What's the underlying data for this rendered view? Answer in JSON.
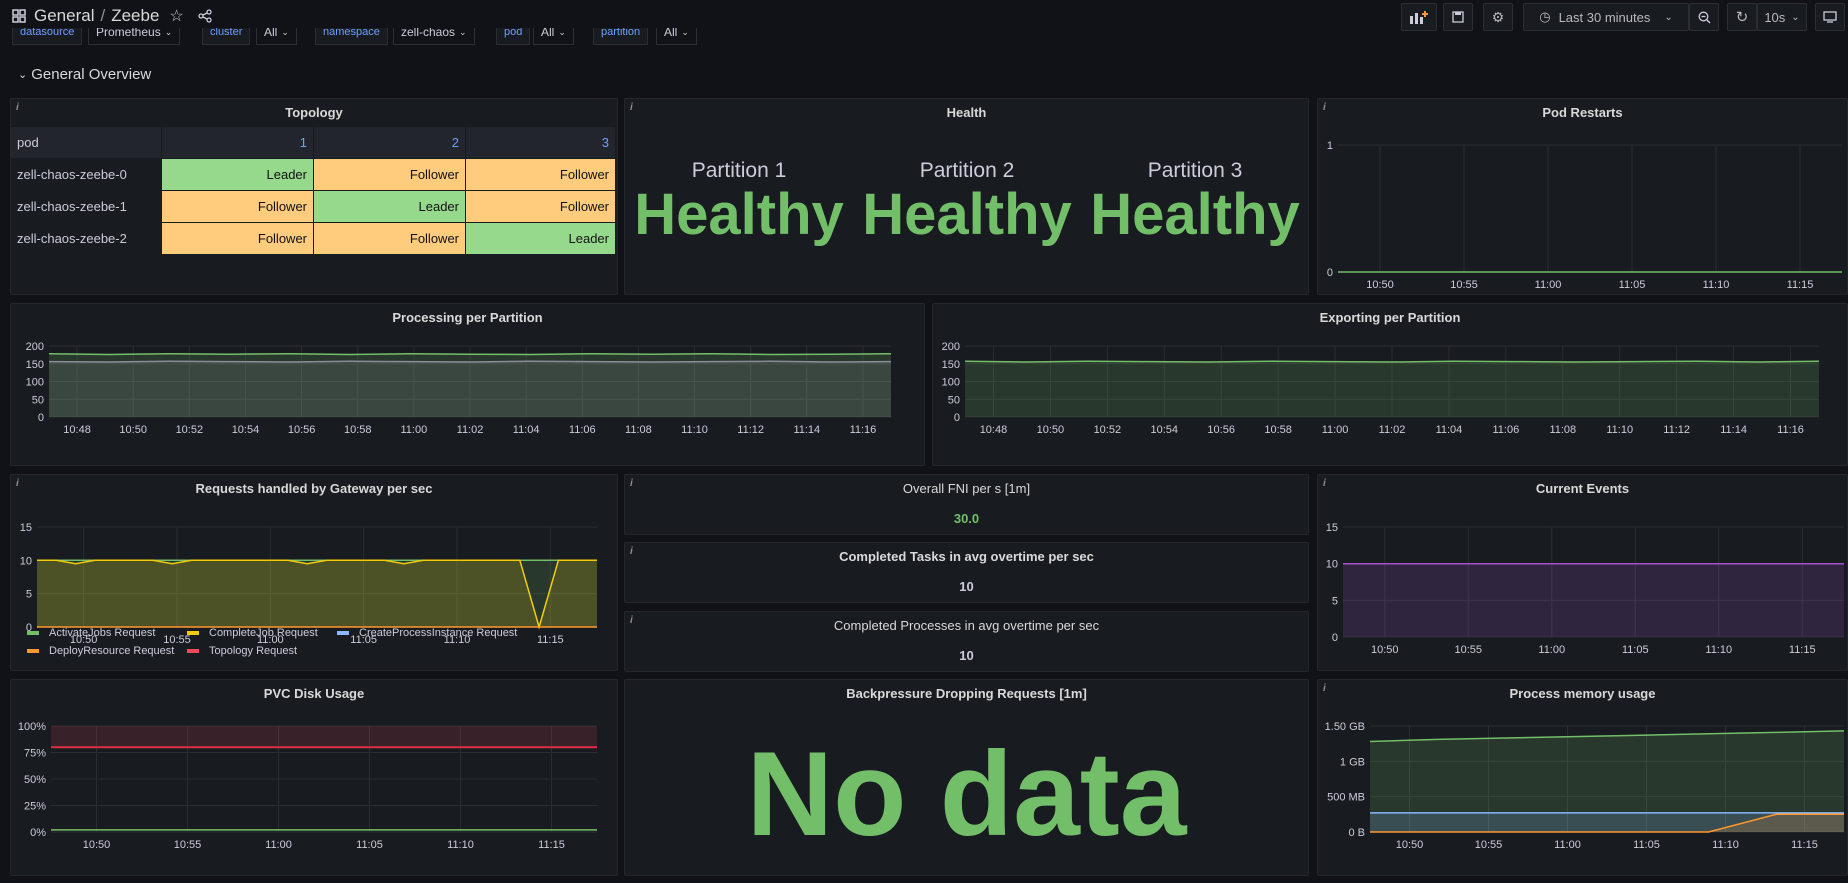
{
  "header": {
    "breadcrumb_folder": "General",
    "breadcrumb_sep": "/",
    "dashboard_title": "Zeebe",
    "time_range": "Last 30 minutes",
    "refresh_interval": "10s"
  },
  "variables": [
    {
      "label": "datasource",
      "value": "Prometheus"
    },
    {
      "label": "cluster",
      "value": "All"
    },
    {
      "label": "namespace",
      "value": "zell-chaos"
    },
    {
      "label": "pod",
      "value": "All"
    },
    {
      "label": "partition",
      "value": "All"
    }
  ],
  "row_title": "General Overview",
  "topology": {
    "title": "Topology",
    "columns": [
      "pod",
      "1",
      "2",
      "3"
    ],
    "rows": [
      {
        "pod": "zell-chaos-zeebe-0",
        "cells": [
          "Leader",
          "Follower",
          "Follower"
        ]
      },
      {
        "pod": "zell-chaos-zeebe-1",
        "cells": [
          "Follower",
          "Leader",
          "Follower"
        ]
      },
      {
        "pod": "zell-chaos-zeebe-2",
        "cells": [
          "Follower",
          "Follower",
          "Leader"
        ]
      }
    ]
  },
  "health": {
    "title": "Health",
    "partitions": [
      {
        "name": "Partition 1",
        "status": "Healthy"
      },
      {
        "name": "Partition 2",
        "status": "Healthy"
      },
      {
        "name": "Partition 3",
        "status": "Healthy"
      }
    ]
  },
  "pod_restarts": {
    "title": "Pod Restarts"
  },
  "processing": {
    "title": "Processing per Partition"
  },
  "exporting": {
    "title": "Exporting per Partition"
  },
  "gateway": {
    "title": "Requests handled by Gateway per sec",
    "legend": [
      {
        "name": "ActivateJobs Request",
        "color": "#73bf69"
      },
      {
        "name": "CompleteJob Request",
        "color": "#f2cc0c"
      },
      {
        "name": "CreateProcessInstance Request",
        "color": "#8ab8ff"
      },
      {
        "name": "DeployResource Request",
        "color": "#ff9830"
      },
      {
        "name": "Topology Request",
        "color": "#f2495c"
      }
    ]
  },
  "fni": {
    "title": "Overall FNI per s [1m]",
    "value": "30.0"
  },
  "completed_tasks": {
    "title": "Completed Tasks in avg overtime per sec",
    "value": "10"
  },
  "completed_processes": {
    "title": "Completed Processes in avg overtime per sec",
    "value": "10"
  },
  "current_events": {
    "title": "Current Events"
  },
  "pvc": {
    "title": "PVC Disk Usage"
  },
  "backpressure": {
    "title": "Backpressure Dropping Requests [1m]",
    "value": "No data"
  },
  "memory": {
    "title": "Process memory usage"
  },
  "chart_data": [
    {
      "id": "pod_restarts",
      "type": "line",
      "title": "Pod Restarts",
      "x": [
        "10:50",
        "10:55",
        "11:00",
        "11:05",
        "11:10",
        "11:15"
      ],
      "yticks": [
        "0",
        "1"
      ],
      "ylim": [
        0,
        1
      ],
      "series": [
        {
          "color": "#73bf69",
          "values": [
            0,
            0,
            0,
            0,
            0,
            0
          ]
        }
      ]
    },
    {
      "id": "processing",
      "type": "area",
      "title": "Processing per Partition",
      "x": [
        "10:48",
        "10:50",
        "10:52",
        "10:54",
        "10:56",
        "10:58",
        "11:00",
        "11:02",
        "11:04",
        "11:06",
        "11:08",
        "11:10",
        "11:12",
        "11:14",
        "11:16"
      ],
      "yticks": [
        "0",
        "50",
        "100",
        "150",
        "200"
      ],
      "ylim": [
        0,
        200
      ],
      "series": [
        {
          "color": "#73bf69",
          "values": [
            178,
            176,
            178,
            177,
            178,
            176,
            178,
            177,
            176,
            178,
            177,
            178,
            176,
            177,
            178
          ]
        },
        {
          "color": "#8e8e9a",
          "values": [
            156,
            155,
            157,
            156,
            155,
            157,
            156,
            155,
            157,
            156,
            155,
            156,
            157,
            155,
            156
          ]
        }
      ]
    },
    {
      "id": "exporting",
      "type": "area",
      "title": "Exporting per Partition",
      "x": [
        "10:48",
        "10:50",
        "10:52",
        "10:54",
        "10:56",
        "10:58",
        "11:00",
        "11:02",
        "11:04",
        "11:06",
        "11:08",
        "11:10",
        "11:12",
        "11:14",
        "11:16"
      ],
      "yticks": [
        "0",
        "50",
        "100",
        "150",
        "200"
      ],
      "ylim": [
        0,
        200
      ],
      "series": [
        {
          "color": "#73bf69",
          "values": [
            157,
            155,
            157,
            156,
            155,
            157,
            156,
            155,
            157,
            156,
            155,
            156,
            157,
            155,
            157
          ]
        }
      ]
    },
    {
      "id": "gateway",
      "type": "area",
      "title": "Requests handled by Gateway per sec",
      "x": [
        "10:50",
        "10:55",
        "11:00",
        "11:05",
        "11:10",
        "11:15"
      ],
      "yticks": [
        "0",
        "5",
        "10",
        "15"
      ],
      "ylim": [
        0,
        15
      ],
      "series": [
        {
          "name": "ActivateJobs Request",
          "color": "#73bf69",
          "values": [
            10,
            10,
            10,
            10,
            10,
            10,
            10,
            10,
            10,
            10,
            10,
            10,
            10,
            10,
            10,
            10,
            10,
            10,
            10,
            10,
            10,
            10,
            10,
            10,
            10,
            10,
            10,
            10,
            10,
            10
          ]
        },
        {
          "name": "CompleteJob Request",
          "color": "#f2cc0c",
          "values": [
            10,
            10,
            9.5,
            10,
            10,
            10,
            10,
            9.5,
            10,
            10,
            10,
            10,
            10,
            10,
            9.5,
            10,
            10,
            10,
            10,
            9.5,
            10,
            10,
            10,
            10,
            10,
            10,
            0,
            10,
            10,
            10
          ]
        },
        {
          "name": "DeployResource Request",
          "color": "#ff9830",
          "values": [
            0,
            0,
            0,
            0,
            0,
            0,
            0,
            0,
            0,
            0,
            0,
            0,
            0,
            0,
            0,
            0,
            0,
            0,
            0,
            0,
            0,
            0,
            0,
            0,
            0,
            0,
            0,
            0,
            0,
            0
          ]
        }
      ]
    },
    {
      "id": "current_events",
      "type": "area",
      "title": "Current Events",
      "x": [
        "10:50",
        "10:55",
        "11:00",
        "11:05",
        "11:10",
        "11:15"
      ],
      "yticks": [
        "0",
        "5",
        "10",
        "15"
      ],
      "ylim": [
        0,
        15
      ],
      "series": [
        {
          "color": "#a352cc",
          "values": [
            10,
            10,
            10,
            10,
            10,
            10
          ]
        }
      ]
    },
    {
      "id": "pvc",
      "type": "line",
      "title": "PVC Disk Usage",
      "x": [
        "10:50",
        "10:55",
        "11:00",
        "11:05",
        "11:10",
        "11:15"
      ],
      "yticks": [
        "0%",
        "25%",
        "50%",
        "75%",
        "100%"
      ],
      "ylim": [
        0,
        100
      ],
      "threshold": 80,
      "series": [
        {
          "color": "#73bf69",
          "values": [
            2,
            2,
            2,
            2,
            2,
            2
          ]
        }
      ]
    },
    {
      "id": "memory",
      "type": "area",
      "title": "Process memory usage",
      "x": [
        "10:50",
        "10:55",
        "11:00",
        "11:05",
        "11:10",
        "11:15"
      ],
      "yticks": [
        "0 B",
        "500 MB",
        "1 GB",
        "1.50 GB"
      ],
      "ylim": [
        0,
        1.5
      ],
      "series": [
        {
          "color": "#73bf69",
          "values": [
            1.28,
            1.31,
            1.33,
            1.35,
            1.37,
            1.39,
            1.41,
            1.43
          ]
        },
        {
          "color": "#8ab8ff",
          "values": [
            0.27,
            0.27,
            0.27,
            0.27,
            0.27,
            0.27,
            0.27,
            0.27
          ]
        },
        {
          "color": "#ff9830",
          "values": [
            0,
            0,
            0,
            0,
            0,
            0,
            0.25,
            0.25
          ]
        }
      ]
    }
  ]
}
